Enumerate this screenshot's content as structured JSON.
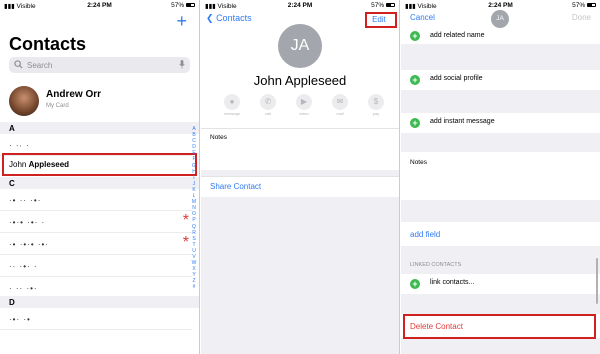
{
  "panel1": {
    "status": {
      "carrier": "Visible",
      "time": "2:24 PM",
      "battery": "57%"
    },
    "title": "Contacts",
    "search_placeholder": "Search",
    "my_card": {
      "name": "Andrew Orr",
      "subtitle": "My Card"
    },
    "sections": [
      {
        "letter": "A",
        "rows": [
          {
            "name": "· ·∙ ·"
          }
        ]
      },
      {
        "letter": "",
        "rows": [
          {
            "name_first": "John",
            "name_last": "Appleseed"
          }
        ]
      },
      {
        "letter": "C",
        "rows": [
          {
            "name": "·• ·· ·•·"
          },
          {
            "name": "·•·• ·•· ·"
          },
          {
            "name": "·• ·•·• ·•·"
          },
          {
            "name": "·· ·•· ·"
          },
          {
            "name": "· ·· ·•·"
          }
        ]
      },
      {
        "letter": "D",
        "rows": [
          {
            "name": "·•· ·•"
          }
        ]
      }
    ],
    "index_letters": [
      "A",
      "B",
      "C",
      "D",
      "E",
      "F",
      "G",
      "H",
      "I",
      "J",
      "K",
      "L",
      "M",
      "N",
      "O",
      "P",
      "Q",
      "R",
      "S",
      "T",
      "U",
      "V",
      "W",
      "X",
      "Y",
      "Z",
      "#"
    ],
    "highlight_color": "#d0201f",
    "accent": "#2f7bf6"
  },
  "panel2": {
    "status": {
      "carrier": "Visible",
      "time": "2:24 PM",
      "battery": "57%"
    },
    "back_label": "Contacts",
    "edit_label": "Edit",
    "initials": "JA",
    "name": "John Appleseed",
    "actions": [
      {
        "icon": "message-icon",
        "glyph": "💬",
        "label": "message"
      },
      {
        "icon": "phone-icon",
        "glyph": "✆",
        "label": "call"
      },
      {
        "icon": "video-icon",
        "glyph": "▶",
        "label": "video"
      },
      {
        "icon": "mail-icon",
        "glyph": "✉",
        "label": "mail"
      },
      {
        "icon": "pay-icon",
        "glyph": "$",
        "label": "pay"
      }
    ],
    "notes_label": "Notes",
    "share_label": "Share Contact"
  },
  "panel3": {
    "status": {
      "carrier": "Visible",
      "time": "2:24 PM",
      "battery": "57%"
    },
    "cancel_label": "Cancel",
    "initials": "JA",
    "done_label": "Done",
    "add_rows": [
      "add related name",
      "add social profile",
      "add instant message"
    ],
    "notes_label": "Notes",
    "add_field_label": "add field",
    "linked_header": "LINKED CONTACTS",
    "link_contacts_label": "link contacts...",
    "delete_label": "Delete Contact"
  }
}
